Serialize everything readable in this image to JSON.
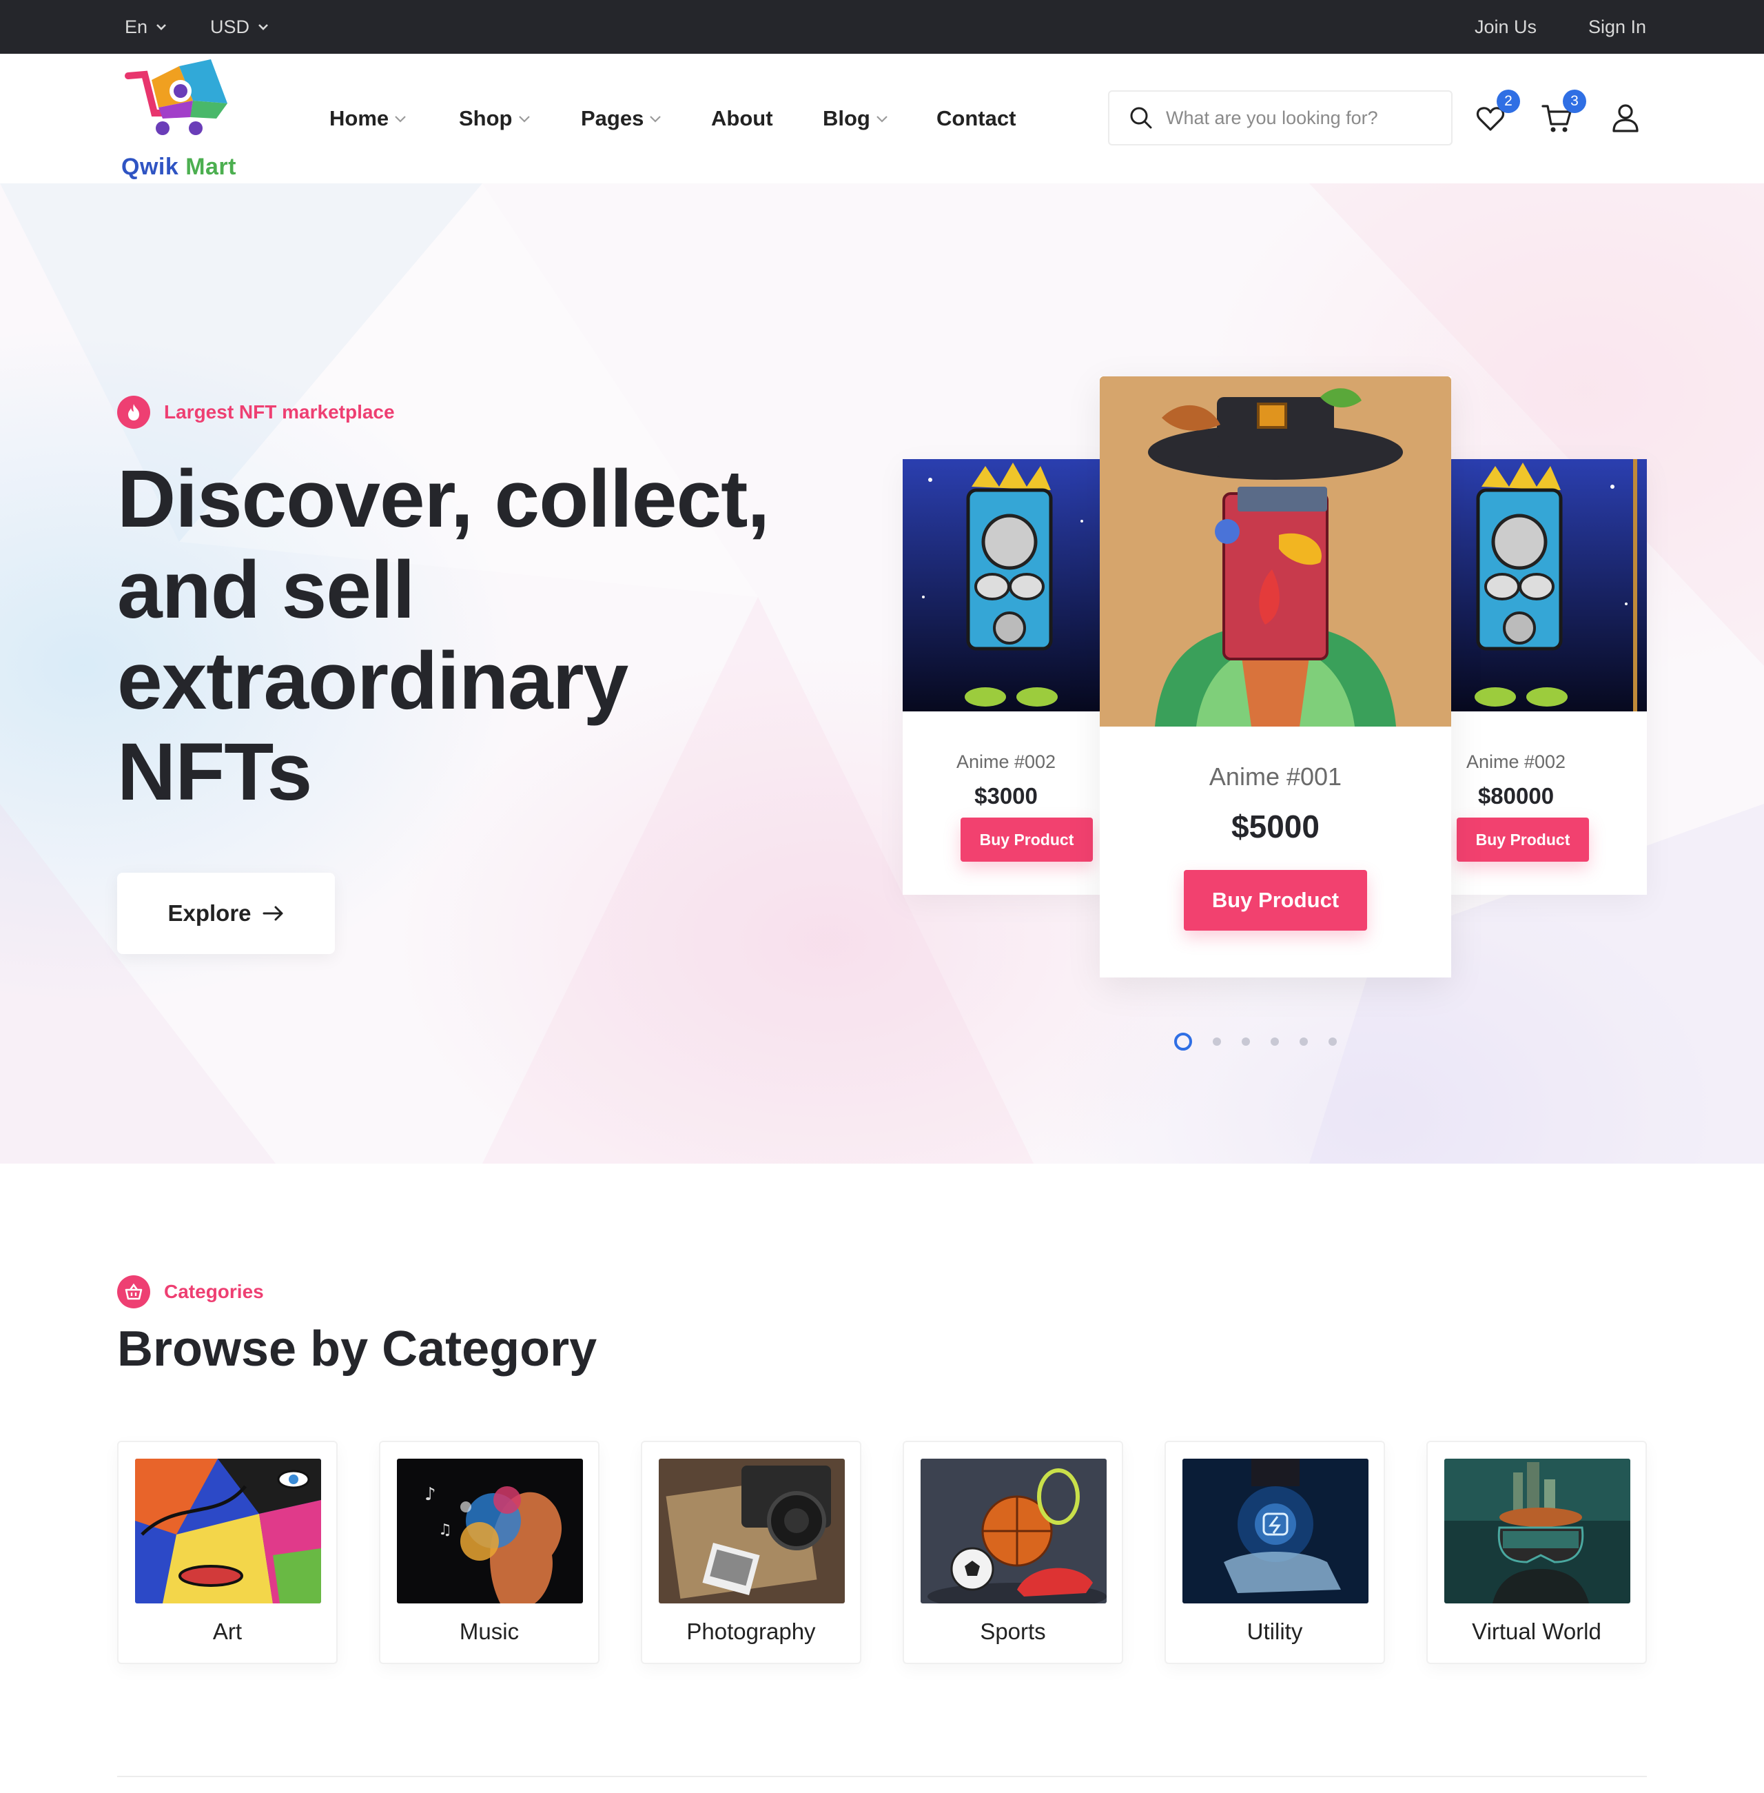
{
  "topbar": {
    "language": "En",
    "currency": "USD",
    "join": "Join Us",
    "signin": "Sign In"
  },
  "logo": {
    "word1": "Qwik",
    "word2": "Mart"
  },
  "nav": [
    {
      "label": "Home",
      "dropdown": true
    },
    {
      "label": "Shop",
      "dropdown": true
    },
    {
      "label": "Pages",
      "dropdown": true
    },
    {
      "label": "About",
      "dropdown": false
    },
    {
      "label": "Blog",
      "dropdown": true
    },
    {
      "label": "Contact",
      "dropdown": false
    }
  ],
  "search": {
    "placeholder": "What are you looking for?"
  },
  "header_icons": {
    "wishlist_count": "2",
    "cart_count": "3"
  },
  "hero": {
    "tag": "Largest NFT marketplace",
    "title": "Discover, collect, and sell extraordinary NFTs",
    "explore": "Explore",
    "cards": [
      {
        "name": "Anime #002",
        "price": "$3000",
        "button": "Buy Product"
      },
      {
        "name": "Anime #001",
        "price": "$5000",
        "button": "Buy Product"
      },
      {
        "name": "Anime #002",
        "price": "$80000",
        "button": "Buy Product"
      }
    ],
    "slider_dots": 6,
    "active_dot": 1
  },
  "categories": {
    "tag": "Categories",
    "title": "Browse by Category",
    "items": [
      {
        "label": "Art"
      },
      {
        "label": "Music"
      },
      {
        "label": "Photography"
      },
      {
        "label": "Sports"
      },
      {
        "label": "Utility"
      },
      {
        "label": "Virtual World"
      }
    ]
  },
  "colors": {
    "accent": "#f2416f",
    "badge": "#2f6fe4",
    "topbar": "#25262b",
    "heading": "#25262b"
  }
}
